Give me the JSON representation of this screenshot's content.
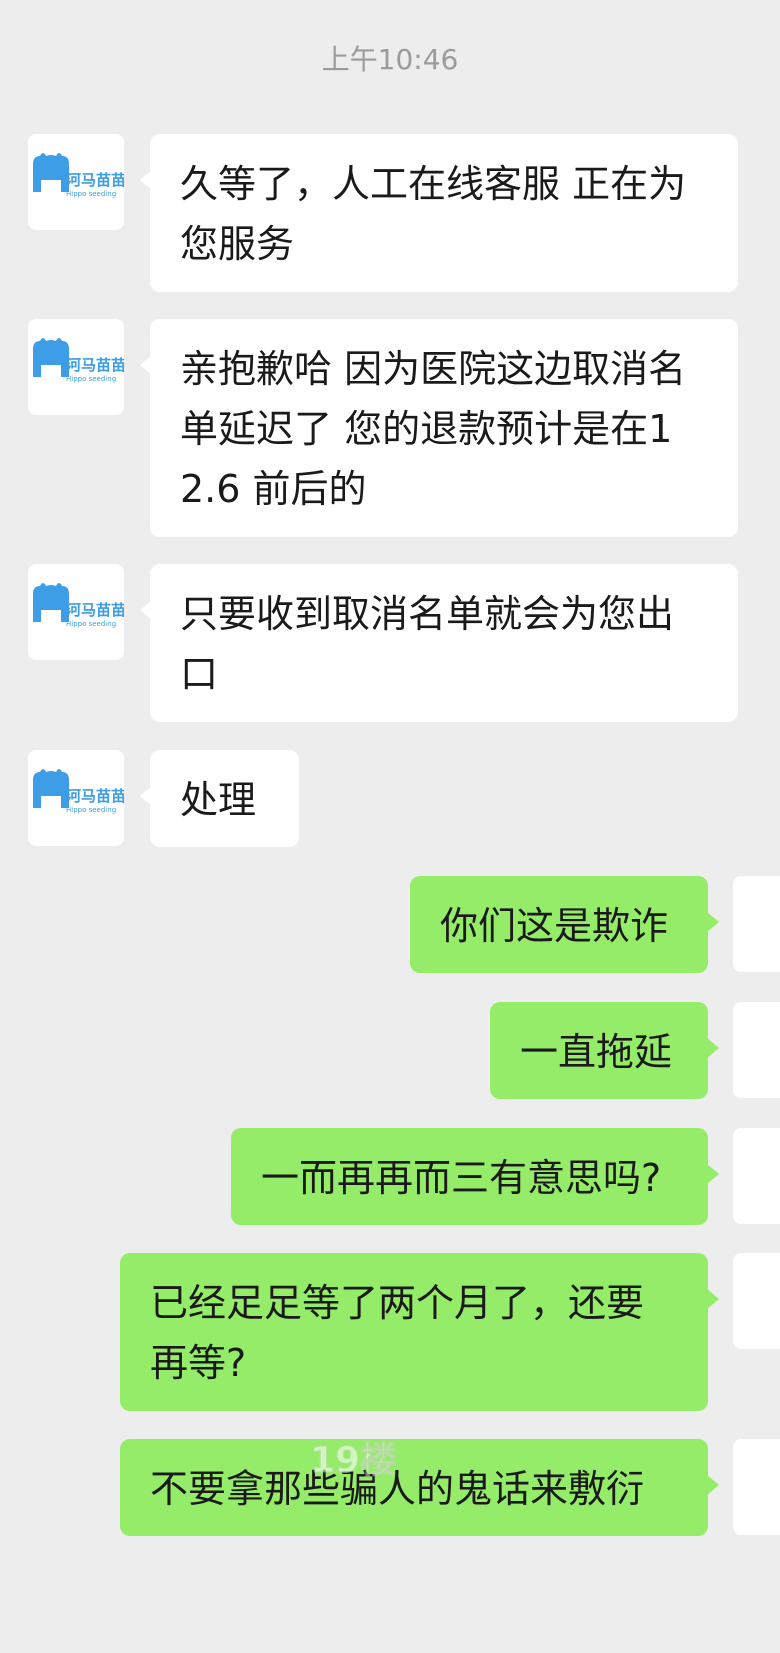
{
  "time_label": "上午10:46",
  "contact_avatar": {
    "brand_cn": "河马苗苗",
    "brand_en": "Hippo seeding",
    "color": "#3d9de6"
  },
  "messages": [
    {
      "side": "in",
      "text": "久等了，人工在线客服 正在为您服务"
    },
    {
      "side": "in",
      "text": "亲抱歉哈 因为医院这边取消名单延迟了 您的退款预计是在12.6 前后的"
    },
    {
      "side": "in",
      "text": "只要收到取消名单就会为您出口"
    },
    {
      "side": "in",
      "text": "处理"
    },
    {
      "side": "out",
      "text": "你们这是欺诈"
    },
    {
      "side": "out",
      "text": "一直拖延"
    },
    {
      "side": "out",
      "text": "一而再再而三有意思吗?"
    },
    {
      "side": "out",
      "text": "已经足足等了两个月了，还要再等?"
    },
    {
      "side": "out",
      "text": "不要拿那些骗人的鬼话来敷衍"
    }
  ],
  "colors": {
    "background": "#ededed",
    "incoming_bubble": "#ffffff",
    "outgoing_bubble": "#95ec69"
  },
  "watermark": {
    "text": "19楼"
  }
}
